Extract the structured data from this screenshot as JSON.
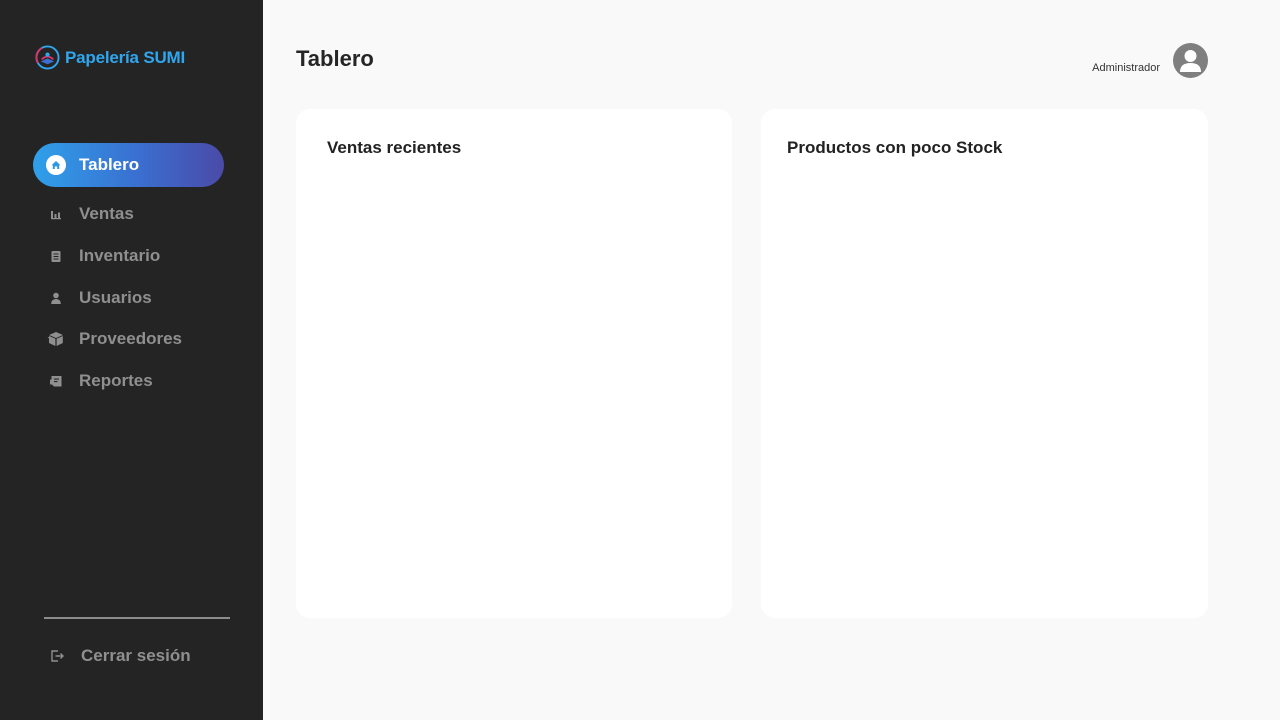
{
  "brand": {
    "name": "Papelería SUMI",
    "color": "#2fa6ee"
  },
  "sidebar": {
    "items": [
      {
        "label": "Tablero",
        "icon": "home-icon",
        "active": true
      },
      {
        "label": "Ventas",
        "icon": "bar-chart-icon",
        "active": false
      },
      {
        "label": "Inventario",
        "icon": "clipboard-list-icon",
        "active": false
      },
      {
        "label": "Usuarios",
        "icon": "user-icon",
        "active": false
      },
      {
        "label": "Proveedores",
        "icon": "box-icon",
        "active": false
      },
      {
        "label": "Reportes",
        "icon": "report-icon",
        "active": false
      }
    ],
    "logout_label": "Cerrar sesión"
  },
  "header": {
    "title": "Tablero",
    "user_role": "Administrador"
  },
  "cards": {
    "recent_sales": {
      "title": "Ventas recientes"
    },
    "low_stock": {
      "title": "Productos con poco Stock"
    }
  },
  "colors": {
    "sidebar_bg": "#242424",
    "accent_start": "#2fa0ea",
    "accent_end": "#4b4aa8",
    "page_bg": "#f9f9f9"
  }
}
